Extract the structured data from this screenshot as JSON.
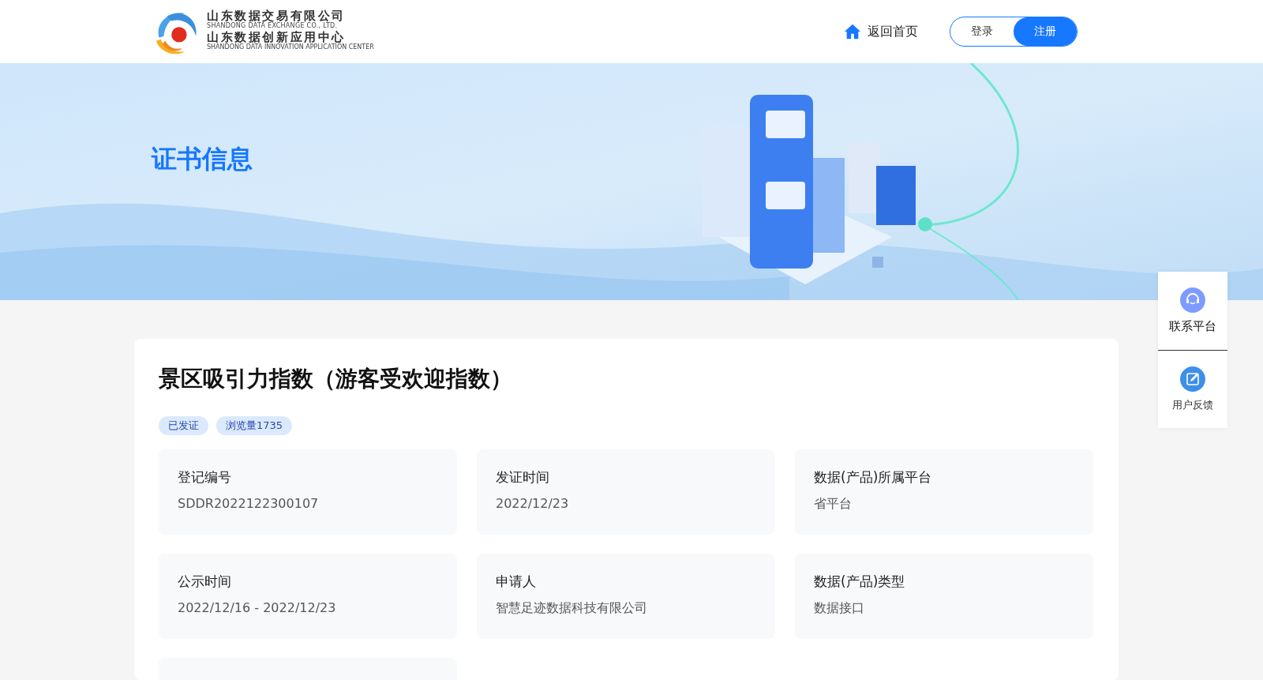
{
  "header": {
    "logo": {
      "name_cn": "山东数据交易有限公司",
      "name_en": "SHANDONG DATA EXCHANGE CO., LTD.",
      "center_cn": "山东数据创新应用中心",
      "center_en": "SHANDONG DATA INNOVATION APPLICATION CENTER"
    },
    "home_link": "返回首页",
    "auth": [
      {
        "label": "登录",
        "selected": false
      },
      {
        "label": "注册",
        "selected": true
      }
    ]
  },
  "banner": {
    "title": "证书信息"
  },
  "certificate": {
    "title": "景区吸引力指数（游客受欢迎指数）",
    "tags": [
      "已发证",
      "浏览量1735"
    ],
    "fields": [
      {
        "kind": "info",
        "label": "登记编号",
        "value": "SDDR2022122300107"
      },
      {
        "kind": "info",
        "label": "发证时间",
        "value": "2022/12/23"
      },
      {
        "kind": "info",
        "label": "数据(产品)所属平台",
        "value": "省平台"
      },
      {
        "kind": "info",
        "label": "公示时间",
        "value": "2022/12/16 - 2022/12/23"
      },
      {
        "kind": "info",
        "label": "申请人",
        "value": "智慧足迹数据科技有限公司"
      },
      {
        "kind": "info",
        "label": "数据(产品)类型",
        "value": "数据接口"
      },
      {
        "kind": "cut_off"
      }
    ]
  },
  "side_panel": [
    {
      "kind": "contact",
      "label": "联系平台"
    },
    {
      "kind": "feedback",
      "label": "用户反馈"
    }
  ]
}
